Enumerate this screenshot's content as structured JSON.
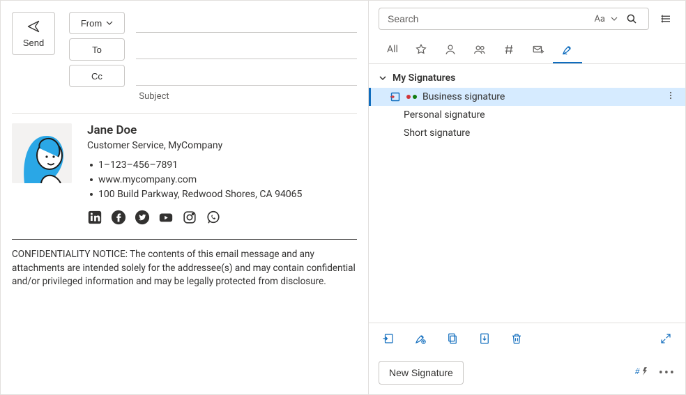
{
  "compose": {
    "send_label": "Send",
    "from_label": "From",
    "to_label": "To",
    "cc_label": "Cc",
    "subject_label": "Subject",
    "from_value": "",
    "to_value": "",
    "cc_value": "",
    "subject_value": ""
  },
  "signature": {
    "name": "Jane Doe",
    "title": "Customer Service, MyCompany",
    "details": [
      "1–123–456–7891",
      "www.mycompany.com",
      "100 Build Parkway, Redwood Shores, CA 94065"
    ],
    "social": [
      "linkedin",
      "facebook",
      "twitter",
      "youtube",
      "instagram",
      "whatsapp"
    ],
    "notice": "CONFIDENTIALITY NOTICE: The contents of this email message and any attachments are intended solely for the addressee(s) and may contain confidential and/or privileged information and may be legally protected from disclosure."
  },
  "sidepanel": {
    "search_placeholder": "Search",
    "case_label": "Aa",
    "tabs": {
      "all_label": "All"
    },
    "tree_header": "My Signatures",
    "items": [
      {
        "label": "Business signature",
        "selected": true,
        "has_dots": true
      },
      {
        "label": "Personal signature",
        "selected": false,
        "has_dots": false
      },
      {
        "label": "Short signature",
        "selected": false,
        "has_dots": false
      }
    ],
    "new_signature_label": "New Signature",
    "hashbolt": "#"
  }
}
